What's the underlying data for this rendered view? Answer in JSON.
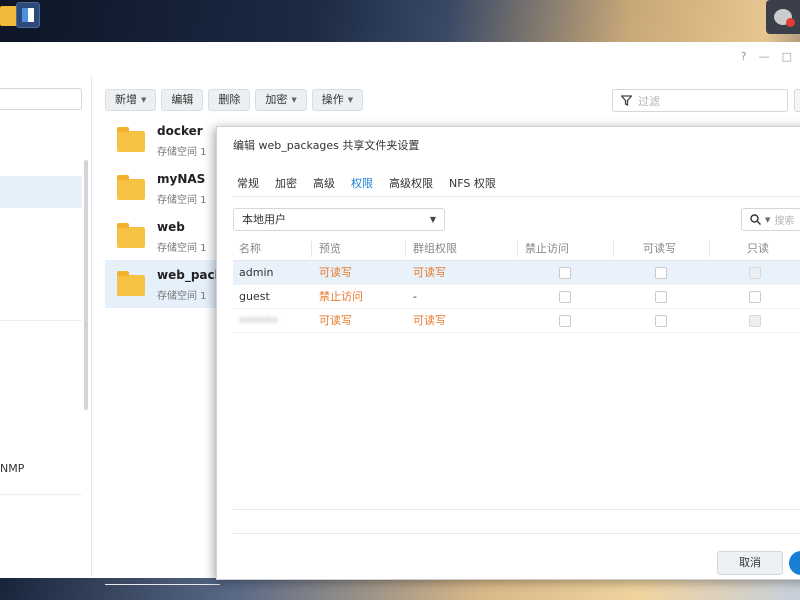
{
  "window": {
    "ctrl_help": "?",
    "ctrl_min": "—",
    "ctrl_close": "□"
  },
  "sidebar": {
    "item_partial": "NMP"
  },
  "toolbar": {
    "new": "新增",
    "edit": "编辑",
    "delete": "删除",
    "encrypt": "加密",
    "action": "操作",
    "filter_placeholder": "过滤"
  },
  "folders": [
    {
      "name": "docker",
      "sub": "存储空间 1"
    },
    {
      "name": "myNAS",
      "sub": "存储空间 1"
    },
    {
      "name": "web",
      "sub": "存储空间 1"
    },
    {
      "name": "web_packages",
      "sub": "存储空间 1"
    }
  ],
  "dialog": {
    "title": "编辑 web_packages 共享文件夹设置",
    "tabs": [
      "常规",
      "加密",
      "高级",
      "权限",
      "高级权限",
      "NFS 权限"
    ],
    "active_tab": "权限",
    "user_source": "本地用户",
    "search_placeholder": "搜索",
    "columns": [
      "名称",
      "预览",
      "群组权限",
      "禁止访问",
      "可读写",
      "只读"
    ],
    "rows": [
      {
        "name": "admin",
        "preview": "可读写",
        "group": "可读写"
      },
      {
        "name": "guest",
        "preview": "禁止访问",
        "group": "-"
      },
      {
        "name": "••••••",
        "preview": "可读写",
        "group": "可读写"
      }
    ],
    "cancel": "取消"
  },
  "colors": {
    "accent": "#1a7fd4",
    "folder": "#f7c143",
    "warn": "#e8792b"
  }
}
